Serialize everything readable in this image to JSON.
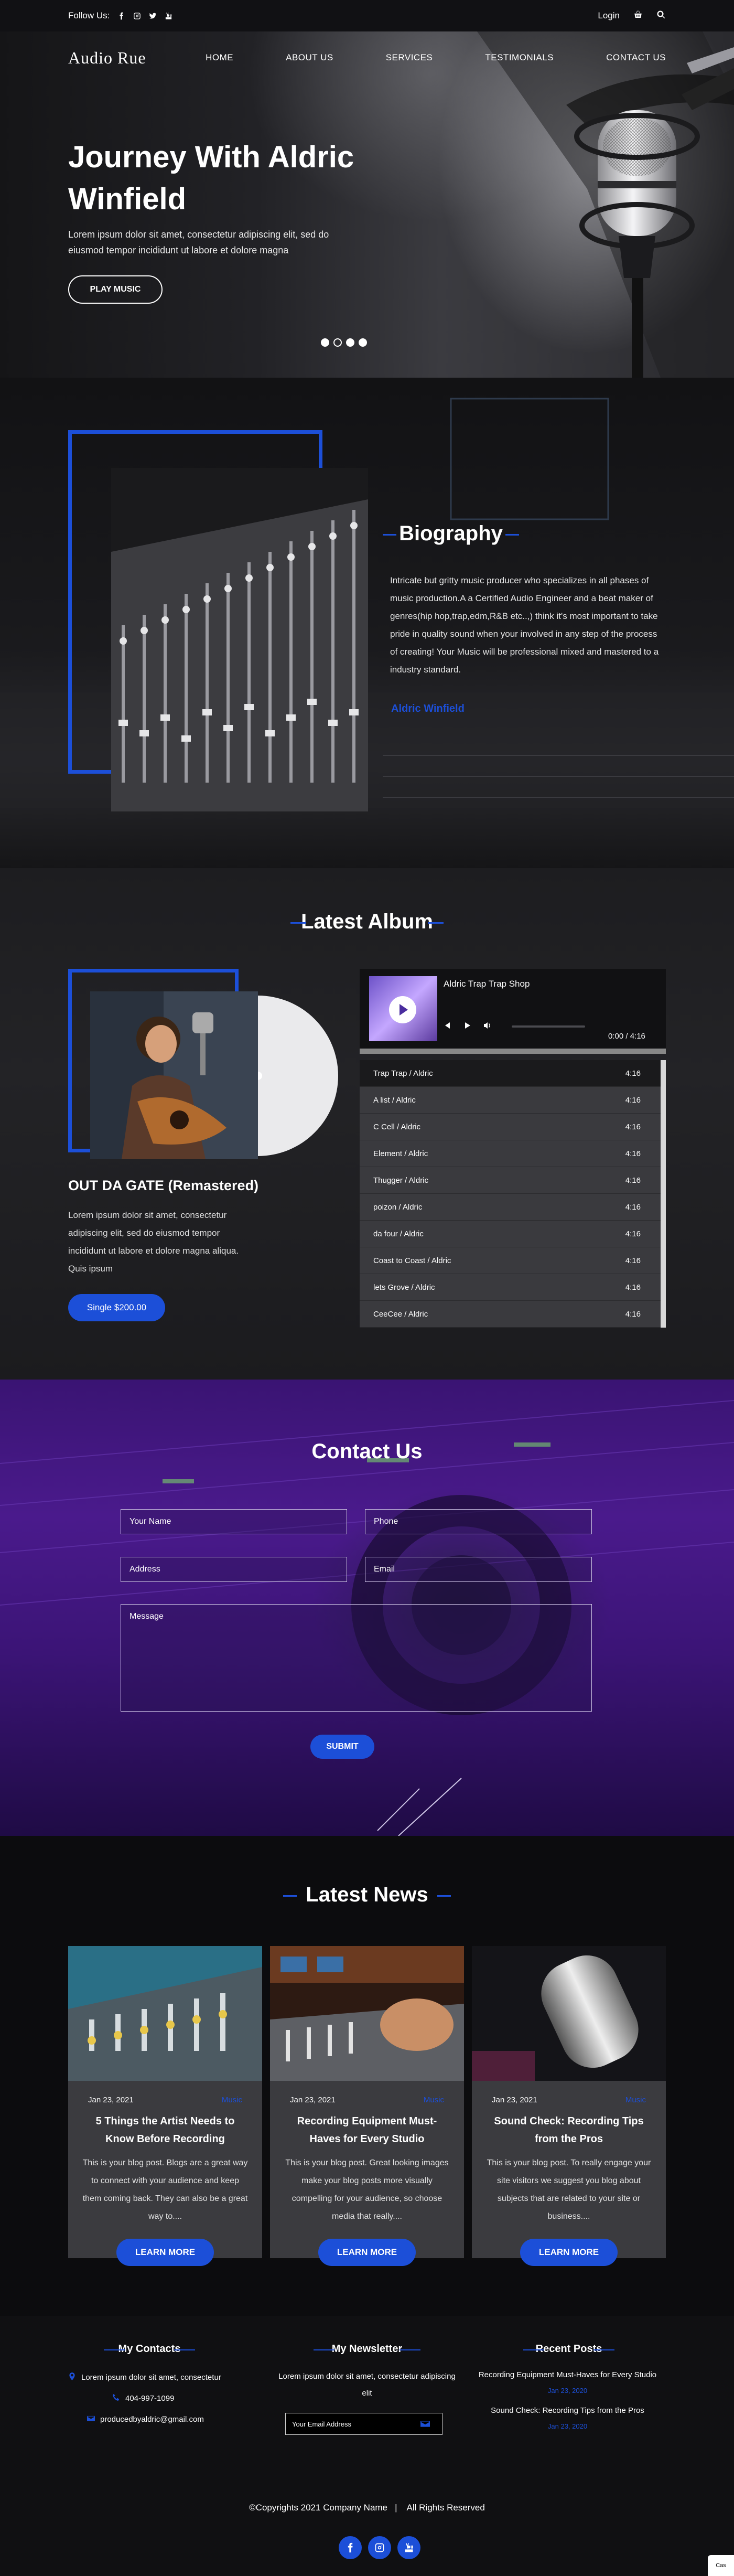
{
  "topbar": {
    "follow_label": "Follow Us:",
    "login_label": "Login"
  },
  "nav": {
    "logo": "Audio Rue",
    "items": [
      "HOME",
      "ABOUT US",
      "SERVICES",
      "TESTIMONIALS",
      "CONTACT US"
    ]
  },
  "hero": {
    "title": "Journey With Aldric Winfield",
    "text": "Lorem ipsum dolor sit amet, consectetur adipiscing elit, sed do eiusmod tempor incididunt ut labore et dolore magna",
    "button": "PLAY MUSIC",
    "active_slide": 2
  },
  "bio": {
    "title": "Biography",
    "text": "Intricate but gritty music producer who specializes in all phases of music production.A a Certified Audio Engineer and a beat maker of genres(hip hop,trap,edm,R&B etc..,) think it's most important to take pride in quality sound when your involved in any step of the process of creating! Your Music will be professional mixed and mastered to a industry standard.",
    "signature": "Aldric Winfield"
  },
  "album": {
    "title": "Latest Album",
    "name": "OUT DA GATE (Remastered)",
    "description": "Lorem ipsum dolor sit amet, consectetur adipiscing elit, sed do eiusmod tempor incididunt ut labore et dolore magna aliqua. Quis ipsum",
    "buy_label": "Single $200.00",
    "player": {
      "track": "Aldric  Trap Trap Shop",
      "time": "0:00  /  4:16"
    },
    "tracks": [
      {
        "name": "Trap Trap / Aldric",
        "duration": "4:16"
      },
      {
        "name": "A list / Aldric",
        "duration": "4:16"
      },
      {
        "name": "C Cell / Aldric",
        "duration": "4:16"
      },
      {
        "name": "Element / Aldric",
        "duration": "4:16"
      },
      {
        "name": "Thugger / Aldric",
        "duration": "4:16"
      },
      {
        "name": "poizon / Aldric",
        "duration": "4:16"
      },
      {
        "name": "da four / Aldric",
        "duration": "4:16"
      },
      {
        "name": "Coast to Coast / Aldric",
        "duration": "4:16"
      },
      {
        "name": "lets Grove / Aldric",
        "duration": "4:16"
      },
      {
        "name": "CeeCee / Aldric",
        "duration": "4:16"
      }
    ]
  },
  "contact": {
    "title": "Contact Us",
    "name_placeholder": "Your Name",
    "phone_placeholder": "Phone",
    "address_placeholder": "Address",
    "email_placeholder": "Email",
    "message_placeholder": "Message",
    "submit": "SUBMIT"
  },
  "news": {
    "title": "Latest News",
    "cards": [
      {
        "date": "Jan 23, 2021",
        "category": "Music",
        "title": "5 Things the Artist Needs to Know Before Recording",
        "text": "This is your blog post. Blogs are a great way to connect with your audience and keep them coming back. They can also be a great way to....",
        "button": "LEARN MORE"
      },
      {
        "date": "Jan 23, 2021",
        "category": "Music",
        "title": "Recording Equipment Must-Haves for Every Studio",
        "text": "This is your blog post. Great looking images make your blog posts more visually compelling for your audience, so choose media that really....",
        "button": "LEARN MORE"
      },
      {
        "date": "Jan 23, 2021",
        "category": "Music",
        "title": "Sound Check: Recording Tips from the Pros",
        "text": "This is your blog post. To really engage your site visitors we suggest you blog about subjects that are related to your site or business....",
        "button": "LEARN MORE"
      }
    ]
  },
  "footer": {
    "contacts_title": "My Contacts",
    "address": "Lorem ipsum dolor sit amet, consectetur",
    "phone": "404-997-1099",
    "email": "producedbyaldric@gmail.com",
    "newsletter_title": "My Newsletter",
    "newsletter_text": "Lorem ipsum dolor sit amet, consectetur adipiscing elit",
    "newsletter_placeholder": "Your Email Address",
    "posts_title": "Recent Posts",
    "posts": [
      {
        "title": "Recording Equipment Must-Haves for Every Studio",
        "date": "Jan 23, 2020"
      },
      {
        "title": "Sound Check: Recording Tips from the Pros",
        "date": "Jan 23, 2020"
      }
    ],
    "copyright": "©Copyrights 2021 Company Name   |    All Rights Reserved"
  },
  "badge": "Cas",
  "colors": {
    "accent": "#1c4fd8",
    "contact_bg": "#3a1473",
    "card_bg": "#3b3b3f"
  },
  "icons": {
    "social": [
      "facebook-icon",
      "instagram-icon",
      "twitter-icon",
      "youtube-icon"
    ],
    "footer_social": [
      "facebook-icon",
      "instagram-icon",
      "youtube-icon"
    ]
  }
}
